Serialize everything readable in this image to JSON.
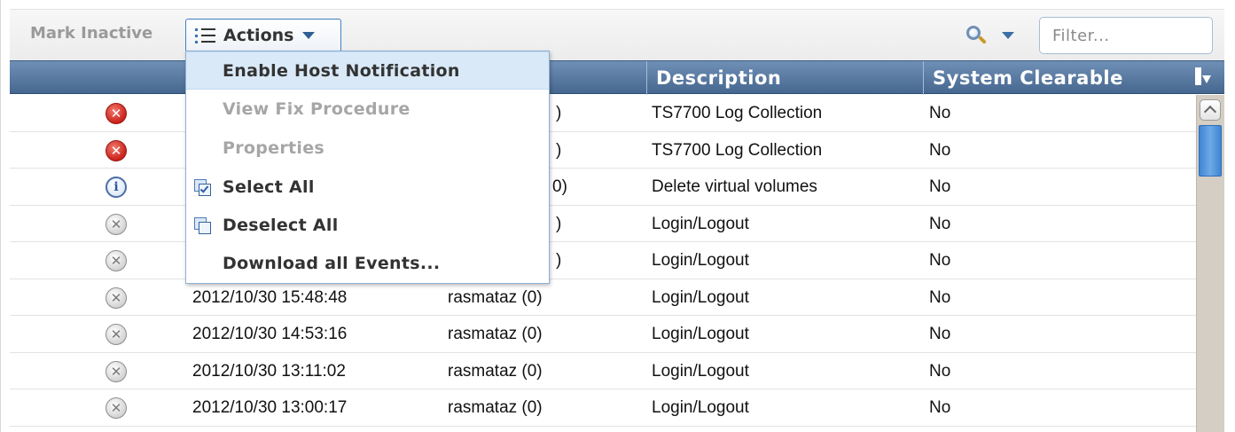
{
  "toolbar": {
    "mark_inactive_label": "Mark Inactive",
    "actions_label": "Actions",
    "filter_placeholder": "Filter..."
  },
  "columns": {
    "description": "Description",
    "system_clearable": "System Clearable"
  },
  "rows": [
    {
      "status": "error",
      "timestamp": "",
      "user": ")",
      "description": "TS7700 Log Collection",
      "clearable": "No"
    },
    {
      "status": "error",
      "timestamp": "",
      "user": ")",
      "description": "TS7700 Log Collection",
      "clearable": "No"
    },
    {
      "status": "info",
      "timestamp": "",
      "user": "0)",
      "description": "Delete virtual volumes",
      "clearable": "No"
    },
    {
      "status": "inactive",
      "timestamp": "",
      "user": ")",
      "description": "Login/Logout",
      "clearable": "No"
    },
    {
      "status": "inactive",
      "timestamp": "",
      "user": ")",
      "description": "Login/Logout",
      "clearable": "No"
    },
    {
      "status": "inactive",
      "timestamp": "2012/10/30 15:48:48",
      "user": "rasmataz (0)",
      "description": "Login/Logout",
      "clearable": "No"
    },
    {
      "status": "inactive",
      "timestamp": "2012/10/30 14:53:16",
      "user": "rasmataz (0)",
      "description": "Login/Logout",
      "clearable": "No"
    },
    {
      "status": "inactive",
      "timestamp": "2012/10/30 13:11:02",
      "user": "rasmataz (0)",
      "description": "Login/Logout",
      "clearable": "No"
    },
    {
      "status": "inactive",
      "timestamp": "2012/10/30 13:00:17",
      "user": "rasmataz (0)",
      "description": "Login/Logout",
      "clearable": "No"
    }
  ],
  "actions_menu": {
    "items": [
      {
        "label": "Enable Host Notification",
        "state": "highlighted",
        "icon": ""
      },
      {
        "label": "View Fix Procedure",
        "state": "disabled",
        "icon": ""
      },
      {
        "label": "Properties",
        "state": "disabled",
        "icon": ""
      },
      {
        "label": "Select All",
        "state": "enabled",
        "icon": "select-all-icon"
      },
      {
        "label": "Deselect All",
        "state": "enabled",
        "icon": "deselect-all-icon"
      },
      {
        "label": "Download all Events...",
        "state": "enabled",
        "icon": ""
      }
    ]
  },
  "colors": {
    "header_bg": "#5a7aa2",
    "menu_highlight": "#d9e9f8",
    "accent_border": "#3f7fc4",
    "scroll_thumb": "#4b8fd8"
  }
}
